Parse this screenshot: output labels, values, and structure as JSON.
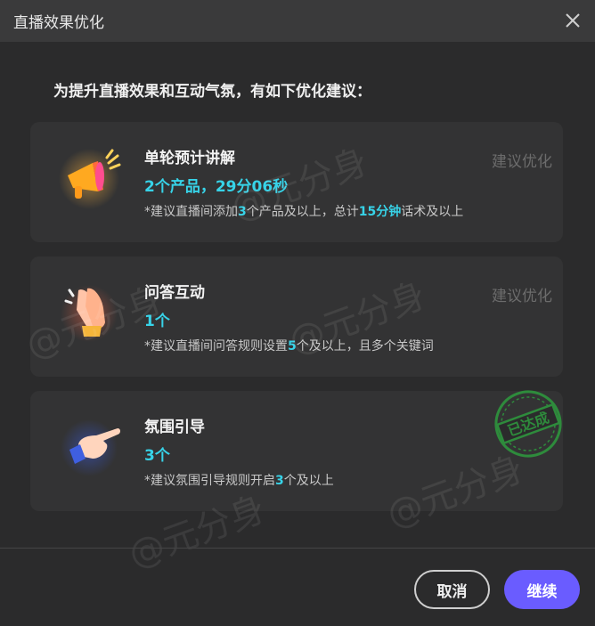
{
  "dialog": {
    "title": "直播效果优化",
    "intro": "为提升直播效果和互动气氛，有如下优化建议："
  },
  "cards": [
    {
      "name": "单轮预计讲解",
      "value": "2个产品，29分06秒",
      "hint_a": "*建议直播间添加",
      "hint_b": "3",
      "hint_c": "个产品及以上，总计",
      "hint_d": "15分钟",
      "hint_e": "话术及以上",
      "status": "建议优化",
      "icon": "megaphone-icon"
    },
    {
      "name": "问答互动",
      "value": "1个",
      "hint_a": "*建议直播间问答规则设置",
      "hint_b": "5",
      "hint_c": "个及以上，且多个关键词",
      "status": "建议优化",
      "icon": "clapping-hands-icon"
    },
    {
      "name": "氛围引导",
      "value": "3个",
      "hint_a": "*建议氛围引导规则开启",
      "hint_b": "3",
      "hint_c": "个及以上",
      "stamp": "已达成",
      "icon": "pointing-hand-icon"
    }
  ],
  "watermark": "@元分身",
  "buttons": {
    "cancel": "取消",
    "continue": "继续"
  },
  "colors": {
    "accent": "#37d3e8",
    "primary_button": "#6a5cff",
    "stamp": "#2e8b3c"
  }
}
